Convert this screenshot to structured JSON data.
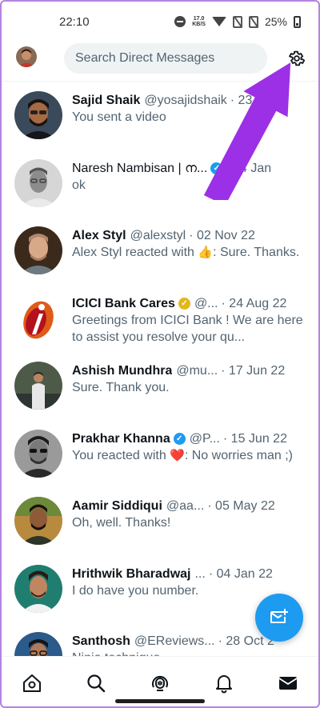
{
  "status_bar": {
    "time": "22:10",
    "speed_top": "17.0",
    "speed_unit": "KB/S",
    "battery": "25%"
  },
  "header": {
    "search_placeholder": "Search Direct Messages"
  },
  "conversations": [
    {
      "name": "Sajid Shaik",
      "handle": "@yosajidshaik",
      "date": "· 23",
      "message": "You sent a video",
      "verified": ""
    },
    {
      "name": "Naresh Nambisan | ന...",
      "handle": "",
      "date": "· 14 Jan",
      "message": "ok",
      "verified": "blue"
    },
    {
      "name": "Alex Styl",
      "handle": "@alexstyl",
      "date": "· 02 Nov 22",
      "message_pre": "Alex Styl reacted with ",
      "emoji": "👍",
      "message_post": ": Sure. Thanks.",
      "verified": ""
    },
    {
      "name": "ICICI Bank Cares",
      "handle": "@...",
      "date": "· 24 Aug 22",
      "message": "Greetings from ICICI Bank ! We are here to assist you resolve your qu...",
      "verified": "gold"
    },
    {
      "name": "Ashish Mundhra",
      "handle": "@mu...",
      "date": "· 17 Jun 22",
      "message": "Sure. Thank you.",
      "verified": ""
    },
    {
      "name": "Prakhar Khanna",
      "handle": "@P...",
      "date": "· 15 Jun 22",
      "message_pre": "You reacted with ",
      "emoji": "❤️",
      "message_post": ": No worries man ;)",
      "verified": "blue"
    },
    {
      "name": "Aamir Siddiqui",
      "handle": "@aa...",
      "date": "· 05 May 22",
      "message": "Oh, well. Thanks!",
      "verified": ""
    },
    {
      "name": "Hrithwik Bharadwaj",
      "handle": "...",
      "date": "· 04 Jan 22",
      "message": "I do have you number.",
      "verified": ""
    },
    {
      "name": "Santhosh",
      "handle": "@EReviews...",
      "date": "· 28 Oct 2",
      "message": "Ninja technique",
      "verified": ""
    }
  ],
  "colors": {
    "accent": "#1d9bf0",
    "annotation_arrow": "#9b30e6",
    "gold_badge": "#e2b719"
  },
  "icons": {
    "settings": "gear-icon",
    "new_message": "new-message-icon",
    "nav": [
      "home-icon",
      "search-icon",
      "spaces-icon",
      "notifications-icon",
      "messages-icon"
    ]
  }
}
